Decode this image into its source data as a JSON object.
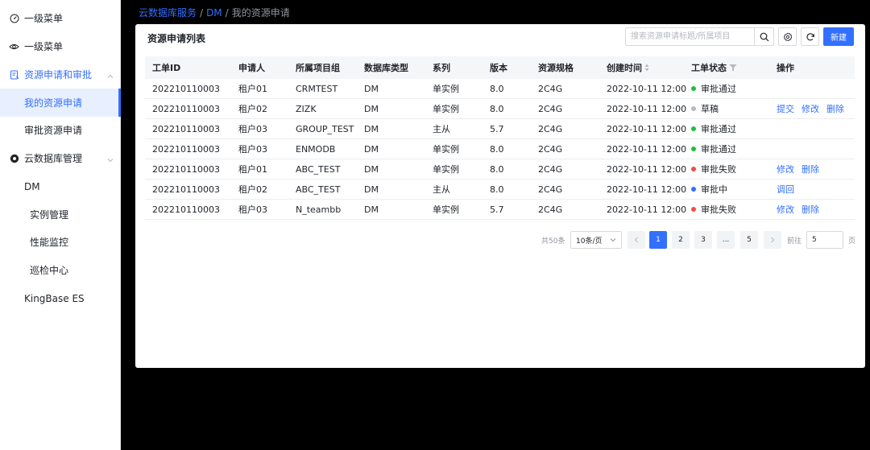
{
  "sidebar": {
    "items": [
      {
        "label": "一级菜单",
        "icon": "dashboard-icon"
      },
      {
        "label": "一级菜单",
        "icon": "eye-icon"
      },
      {
        "label": "资源申请和审批",
        "icon": "form-icon"
      },
      {
        "label": "我的资源申请"
      },
      {
        "label": "审批资源申请"
      },
      {
        "label": "云数据库管理",
        "icon": "database-icon"
      },
      {
        "label": "DM"
      },
      {
        "label": "实例管理"
      },
      {
        "label": "性能监控"
      },
      {
        "label": "巡检中心"
      },
      {
        "label": "KingBase ES"
      }
    ]
  },
  "breadcrumb": {
    "root": "云数据库服务",
    "mid": "DM",
    "current": "我的资源申请",
    "sep": "/"
  },
  "card": {
    "title": "资源申请列表",
    "search_placeholder": "搜索资源申请标题/所属项目",
    "new_label": "新建"
  },
  "table": {
    "headers": [
      "工单ID",
      "申请人",
      "所属项目组",
      "数据库类型",
      "系列",
      "版本",
      "资源规格",
      "创建时间",
      "工单状态",
      "操作"
    ],
    "rows": [
      {
        "id": "202210110003",
        "user": "租户01",
        "group": "CRMTEST",
        "db": "DM",
        "series": "单实例",
        "ver": "8.0",
        "spec": "2C4G",
        "time": "2022-10-11 12:00",
        "status": "审批通过",
        "actions": []
      },
      {
        "id": "202210110003",
        "user": "租户02",
        "group": "ZIZK",
        "db": "DM",
        "series": "单实例",
        "ver": "8.0",
        "spec": "2C4G",
        "time": "2022-10-11 12:00",
        "status": "草稿",
        "actions": [
          "提交",
          "修改",
          "删除"
        ]
      },
      {
        "id": "202210110003",
        "user": "租户03",
        "group": "GROUP_TEST",
        "db": "DM",
        "series": "主从",
        "ver": "5.7",
        "spec": "2C4G",
        "time": "2022-10-11 12:00",
        "status": "审批通过",
        "actions": []
      },
      {
        "id": "202210110003",
        "user": "租户03",
        "group": "ENMODB",
        "db": "DM",
        "series": "单实例",
        "ver": "8.0",
        "spec": "2C4G",
        "time": "2022-10-11 12:00",
        "status": "审批通过",
        "actions": []
      },
      {
        "id": "202210110003",
        "user": "租户01",
        "group": "ABC_TEST",
        "db": "DM",
        "series": "单实例",
        "ver": "8.0",
        "spec": "2C4G",
        "time": "2022-10-11 12:00",
        "status": "审批失败",
        "actions": [
          "修改",
          "删除"
        ]
      },
      {
        "id": "202210110003",
        "user": "租户02",
        "group": "ABC_TEST",
        "db": "DM",
        "series": "主从",
        "ver": "8.0",
        "spec": "2C4G",
        "time": "2022-10-11 12:00",
        "status": "审批中",
        "actions": [
          "调回"
        ]
      },
      {
        "id": "202210110003",
        "user": "租户03",
        "group": "N_teambb",
        "db": "DM",
        "series": "单实例",
        "ver": "5.7",
        "spec": "2C4G",
        "time": "2022-10-11 12:00",
        "status": "审批失败",
        "actions": [
          "修改",
          "删除"
        ]
      }
    ]
  },
  "status_colors": {
    "审批通过": "#1fbf3f",
    "草稿": "#b6b9be",
    "审批失败": "#f54a45",
    "审批中": "#3370ff"
  },
  "pagination": {
    "total": "共50条",
    "page_size": "10条/页",
    "pages": [
      "1",
      "2",
      "3",
      "...",
      "5"
    ],
    "current": "1",
    "goto_label": "前往",
    "goto_value": "5",
    "page_suffix": "页"
  }
}
